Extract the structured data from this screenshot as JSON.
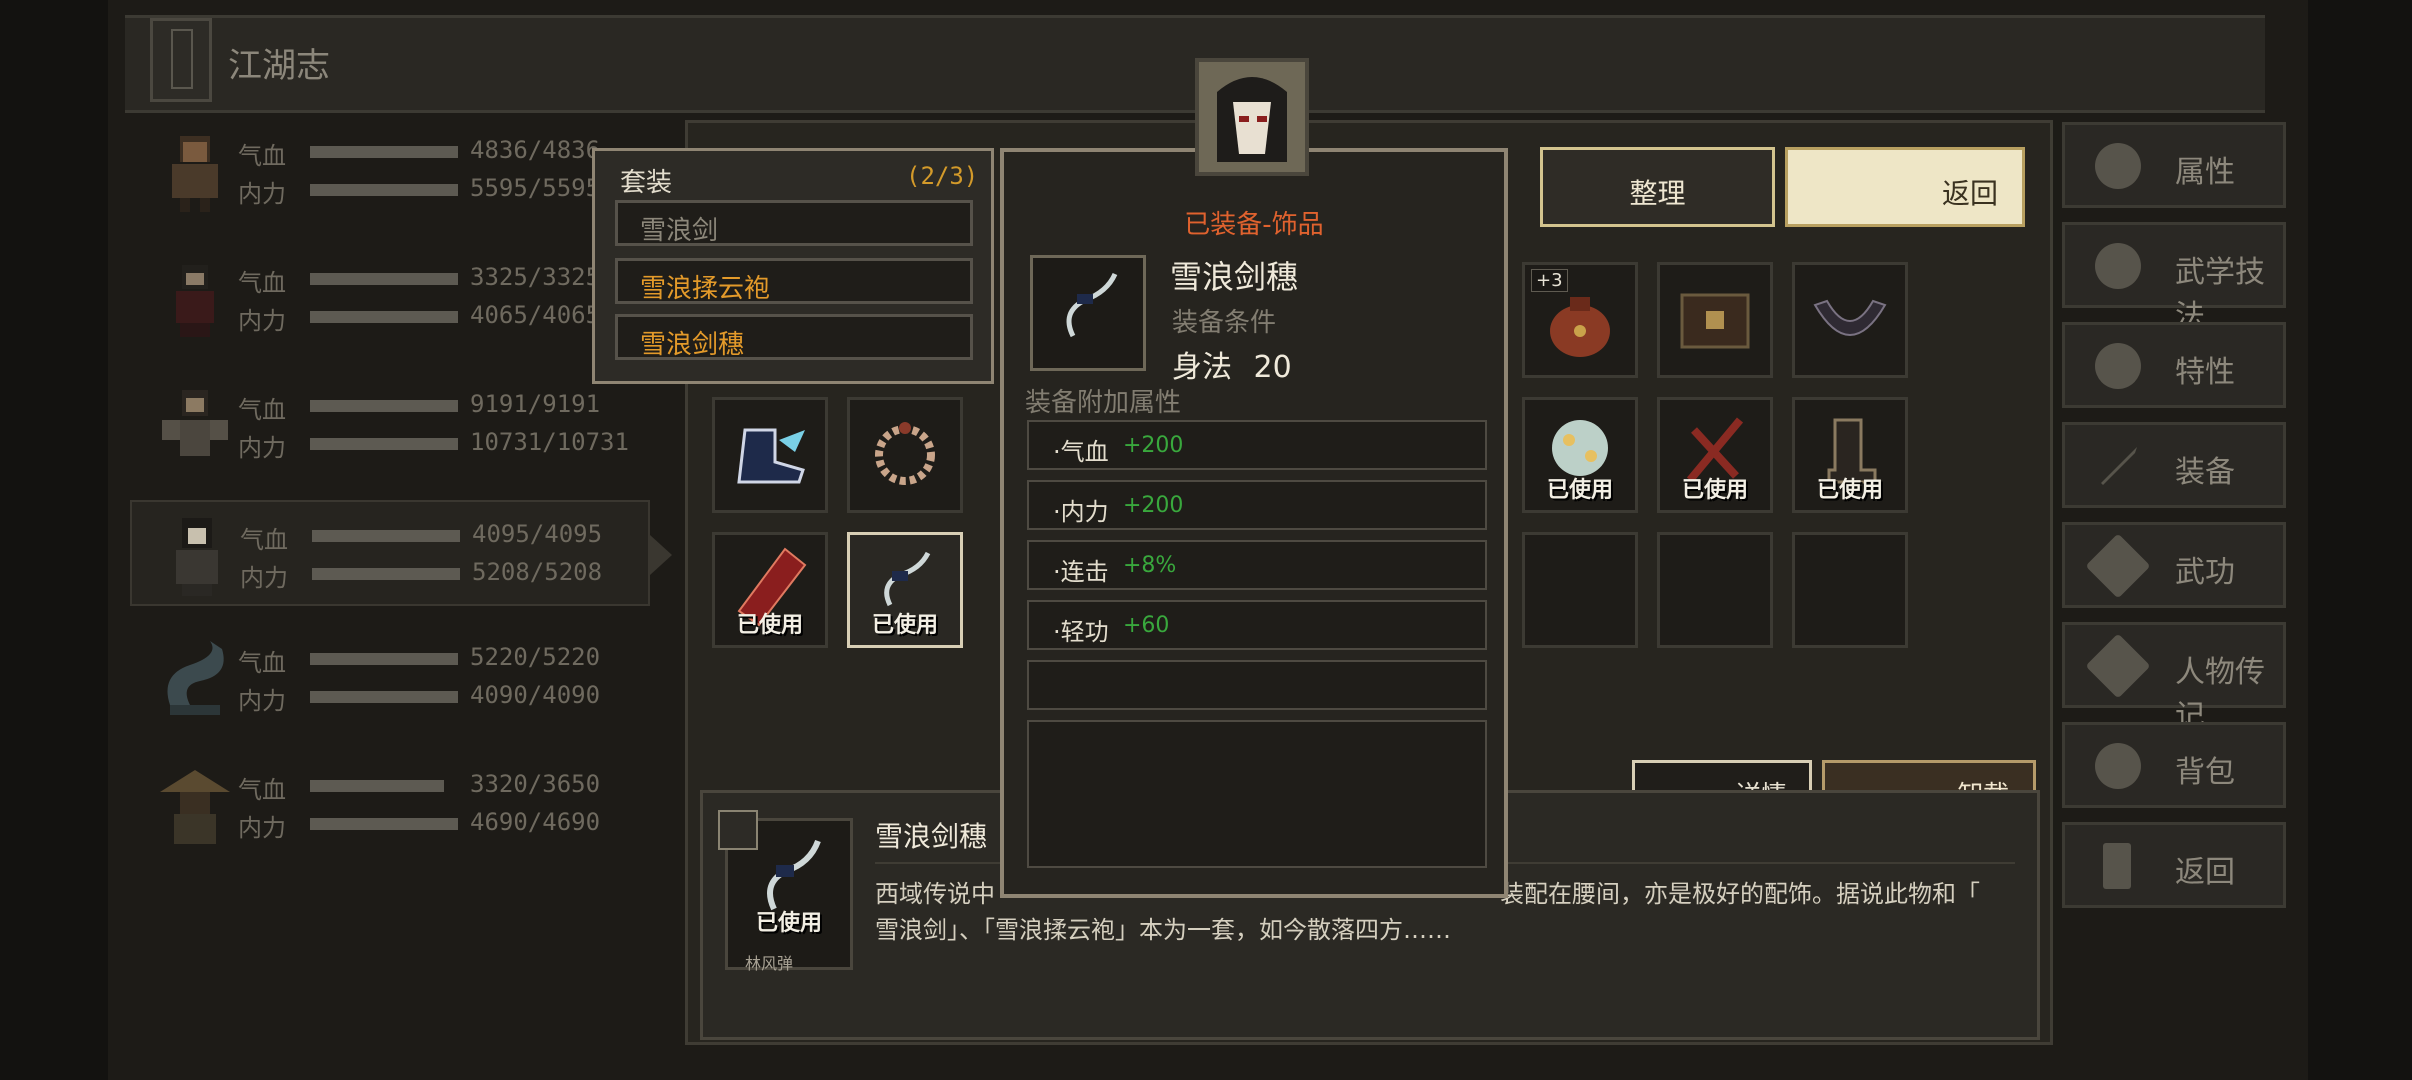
{
  "header": {
    "title": "江湖志"
  },
  "characters": [
    {
      "hp_label": "气血",
      "hp_value": "4836/4836",
      "mp_label": "内力",
      "mp_value": "5595/5595"
    },
    {
      "hp_label": "气血",
      "hp_value": "3325/3325",
      "mp_label": "内力",
      "mp_value": "4065/4065"
    },
    {
      "hp_label": "气血",
      "hp_value": "9191/9191",
      "mp_label": "内力",
      "mp_value": "10731/10731"
    },
    {
      "hp_label": "气血",
      "hp_value": "4095/4095",
      "mp_label": "内力",
      "mp_value": "5208/5208"
    },
    {
      "hp_label": "气血",
      "hp_value": "5220/5220",
      "mp_label": "内力",
      "mp_value": "4090/4090"
    },
    {
      "hp_label": "气血",
      "hp_value": "3320/3650",
      "mp_label": "内力",
      "mp_value": "4690/4690"
    }
  ],
  "menu": [
    {
      "label": "属性",
      "icon": "person-icon"
    },
    {
      "label": "武学技法",
      "icon": "martial-person-icon"
    },
    {
      "label": "特性",
      "icon": "trait-person-icon"
    },
    {
      "label": "装备",
      "icon": "sword-icon"
    },
    {
      "label": "武功",
      "icon": "scroll-icon"
    },
    {
      "label": "人物传记",
      "icon": "book-icon"
    },
    {
      "label": "背包",
      "icon": "bag-icon"
    },
    {
      "label": "返回",
      "icon": "door-icon"
    }
  ],
  "inventory": {
    "sort_label": "整理",
    "return_label": "返回",
    "used_label": "已使用",
    "plus_badge": "+3",
    "detail_label": "详情",
    "unequip_label": "卸载"
  },
  "set_popup": {
    "title": "套装",
    "count": "(2/3)",
    "items": [
      {
        "label": "雪浪剑",
        "color": "#8c877a"
      },
      {
        "label": "雪浪揉云袍",
        "color": "#e39a2a"
      },
      {
        "label": "雪浪剑穗",
        "color": "#e39a2a"
      }
    ]
  },
  "tooltip": {
    "category": "已装备-饰品",
    "name": "雪浪剑穗",
    "requirement_label": "装备条件",
    "requirement_stat": "身法",
    "requirement_value": "20",
    "bonus_label": "装备附加属性",
    "stats": [
      {
        "name": "·气血",
        "value": "+200"
      },
      {
        "name": "·内力",
        "value": "+200"
      },
      {
        "name": "·连击",
        "value": "+8%"
      },
      {
        "name": "·轻功",
        "value": "+60"
      }
    ]
  },
  "description": {
    "name": "雪浪剑穗",
    "owner": "林风弹",
    "used_label": "已使用",
    "text_line1": "西域传说中",
    "text_line1_right": "装配在腰间，亦是极好的配饰。据说此物和「",
    "text_line2": "雪浪剑」、「雪浪揉云袍」本为一套，如今散落四方……"
  }
}
